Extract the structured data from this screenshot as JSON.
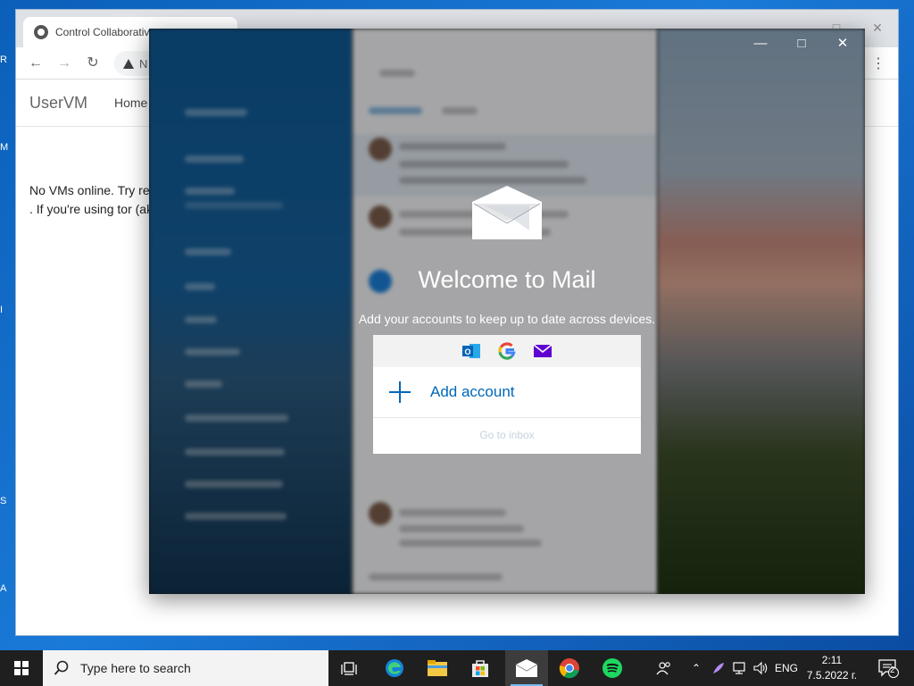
{
  "desktop": {
    "edge_letters": [
      "R",
      "M",
      "I",
      "S",
      "A"
    ]
  },
  "browser": {
    "tab_title": "Control Collaborativ",
    "address_text": "N",
    "brand": "UserVM",
    "nav_home": "Home",
    "content_line1": "No VMs online. Try re",
    "content_line2": ". If you're using tor (ak"
  },
  "mail": {
    "welcome_title": "Welcome to Mail",
    "welcome_subtitle": "Add your accounts to keep up to date across devices.",
    "add_account_label": "Add account",
    "go_to_inbox_label": "Go to inbox",
    "providers": [
      "outlook-icon",
      "google-icon",
      "yahoo-mail-icon"
    ]
  },
  "taskbar": {
    "search_placeholder": "Type here to search",
    "language": "ENG",
    "time": "2:11",
    "date": "7.5.2022 г.",
    "notification_count": "2",
    "pinned": [
      "task-view-icon",
      "edge-icon",
      "file-explorer-icon",
      "store-icon",
      "mail-icon",
      "chrome-icon",
      "spotify-icon"
    ],
    "active_app": "mail-icon"
  },
  "colors": {
    "accent": "#0067b8",
    "taskbar": "#1f1f1f",
    "desktop": "#0b5fb8"
  }
}
